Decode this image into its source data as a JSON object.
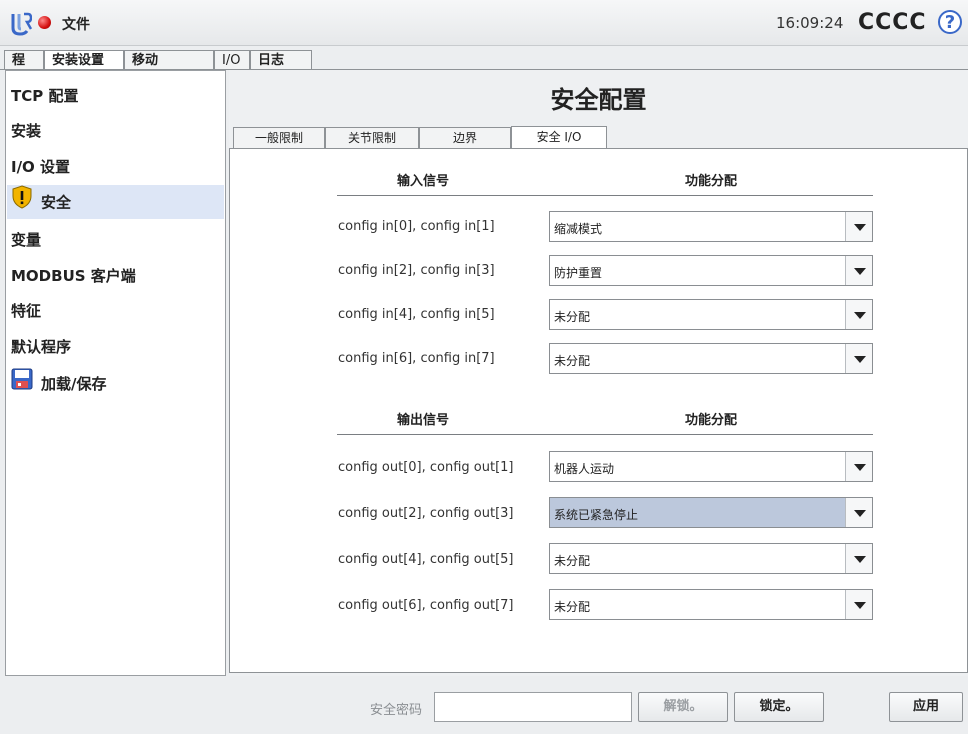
{
  "header": {
    "file_menu": "文件",
    "time": "16:09:24",
    "robot_name": "CCCC",
    "help": "?"
  },
  "main_tabs": [
    "程序",
    "安装设置",
    "移动",
    "I/O",
    "日志"
  ],
  "sidebar": {
    "items": [
      {
        "label": "TCP 配置"
      },
      {
        "label": "安装"
      },
      {
        "label": "I/O 设置"
      },
      {
        "label": "安全"
      },
      {
        "label": "变量"
      },
      {
        "label": "MODBUS 客户端"
      },
      {
        "label": "特征"
      },
      {
        "label": "默认程序"
      },
      {
        "label": "加载/保存"
      }
    ]
  },
  "page": {
    "title": "安全配置",
    "sub_tabs": [
      "一般限制",
      "关节限制",
      "边界",
      "安全 I/O"
    ]
  },
  "inputs": {
    "header_signal": "输入信号",
    "header_function": "功能分配",
    "rows": [
      {
        "label": "config in[0], config in[1]",
        "value": "缩减模式"
      },
      {
        "label": "config in[2], config in[3]",
        "value": "防护重置"
      },
      {
        "label": "config in[4], config in[5]",
        "value": "未分配"
      },
      {
        "label": "config in[6], config in[7]",
        "value": "未分配"
      }
    ]
  },
  "outputs": {
    "header_signal": "输出信号",
    "header_function": "功能分配",
    "rows": [
      {
        "label": "config out[0], config out[1]",
        "value": "机器人运动"
      },
      {
        "label": "config out[2], config out[3]",
        "value": "系统已紧急停止"
      },
      {
        "label": "config out[4], config out[5]",
        "value": "未分配"
      },
      {
        "label": "config out[6], config out[7]",
        "value": "未分配"
      }
    ]
  },
  "footer": {
    "password_label": "安全密码",
    "password_value": "",
    "unlock": "解锁。",
    "lock": "锁定。",
    "apply": "应用"
  },
  "colors": {
    "accent": "#3a68c8",
    "selected_row": "#dde6f6",
    "highlight_dropdown": "#bcc8dc"
  }
}
